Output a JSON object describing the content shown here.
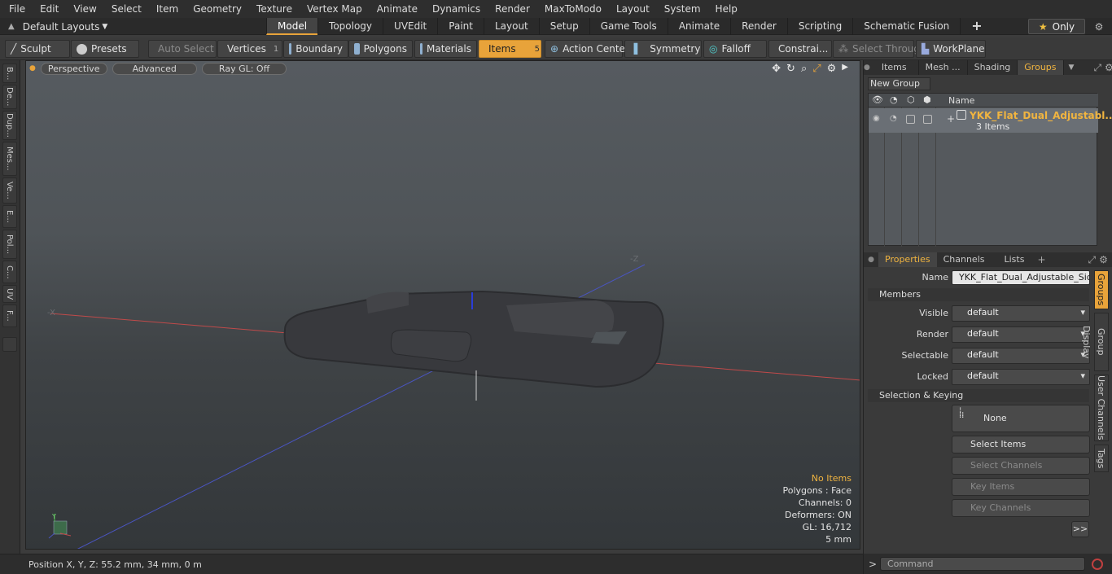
{
  "menu": [
    "File",
    "Edit",
    "View",
    "Select",
    "Item",
    "Geometry",
    "Texture",
    "Vertex Map",
    "Animate",
    "Dynamics",
    "Render",
    "MaxToModo",
    "Layout",
    "System",
    "Help"
  ],
  "layout": {
    "selector": "Default Layouts"
  },
  "tabs": [
    "Model",
    "Topology",
    "UVEdit",
    "Paint",
    "Layout",
    "Setup",
    "Game Tools",
    "Animate",
    "Render",
    "Scripting",
    "Schematic Fusion"
  ],
  "only_label": "Only",
  "toolbar": {
    "sculpt": "Sculpt",
    "presets": "Presets",
    "auto_select": "Auto Select",
    "vertices": "Vertices",
    "vertices_count": "1",
    "boundary": "Boundary",
    "polygons": "Polygons",
    "materials": "Materials",
    "items": "Items",
    "items_count": "5",
    "action_center": "Action Center",
    "symmetry": "Symmetry",
    "falloff": "Falloff",
    "constraints": "Constrai...",
    "select_through": "Select Through",
    "workplane": "WorkPlane"
  },
  "left_tabs": [
    "B...",
    "De...",
    "Dup...",
    "Mes...",
    "Ve...",
    "E...",
    "Pol...",
    "C...",
    "UV",
    "F..."
  ],
  "viewport": {
    "perspective": "Perspective",
    "advanced": "Advanced",
    "raygl": "Ray GL: Off",
    "info": {
      "no_items": "No Items",
      "polygons": "Polygons : Face",
      "channels": "Channels: 0",
      "deformers": "Deformers: ON",
      "gl": "GL: 16,712",
      "scale": "5 mm"
    }
  },
  "status": {
    "position": "Position X, Y, Z:   55.2 mm, 34 mm, 0 m"
  },
  "right_tabs": [
    "Items",
    "Mesh ...",
    "Shading",
    "Groups"
  ],
  "groups": {
    "new_group": "New Group",
    "col_name": "Name",
    "name": "YKK_Flat_Dual_Adjustabl...",
    "count": "3 Items"
  },
  "prop_tabs": [
    "Properties",
    "Channels",
    "Lists"
  ],
  "properties": {
    "name_label": "Name",
    "name_value": "YKK_Flat_Dual_Adjustable_Side_",
    "members_section": "Members",
    "visible_label": "Visible",
    "visible_value": "default",
    "render_label": "Render",
    "render_value": "default",
    "selectable_label": "Selectable",
    "selectable_value": "default",
    "locked_label": "Locked",
    "locked_value": "default",
    "sel_section": "Selection & Keying",
    "none_label": "None",
    "select_items": "Select Items",
    "select_channels": "Select Channels",
    "key_items": "Key Items",
    "key_channels": "Key Channels",
    "more": ">>"
  },
  "prop_vtabs": [
    "Groups",
    "Group Display",
    "User Channels",
    "Tags"
  ],
  "command": {
    "placeholder": "Command"
  }
}
